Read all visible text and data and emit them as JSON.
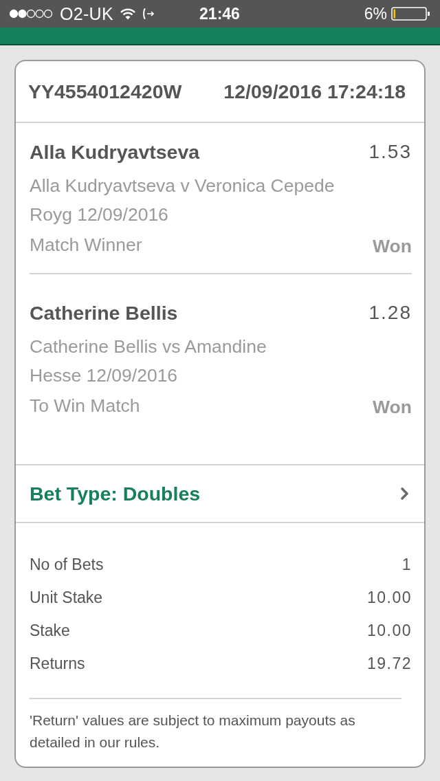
{
  "status_bar": {
    "carrier": "O2-UK",
    "time": "21:46",
    "battery": "6%"
  },
  "header": {
    "reference": "YY4554012420W",
    "date_time": "12/09/2016 17:24:18"
  },
  "selections": [
    {
      "name": "Alla Kudryavtseva",
      "odds": "1.53",
      "event_lines": [
        "Alla Kudryavtseva v Veronica Cepede",
        "Royg 12/09/2016"
      ],
      "market": "Match Winner",
      "result": "Won"
    },
    {
      "name": "Catherine Bellis",
      "odds": "1.28",
      "event_lines": [
        "Catherine Bellis vs Amandine",
        "Hesse 12/09/2016"
      ],
      "market": "To Win Match",
      "result": "Won"
    }
  ],
  "bet_type": {
    "label": "Bet Type: Doubles"
  },
  "summary": [
    {
      "label": "No of Bets",
      "value": "1"
    },
    {
      "label": "Unit Stake",
      "value": "10.00"
    },
    {
      "label": "Stake",
      "value": "10.00"
    },
    {
      "label": "Returns",
      "value": "19.72"
    }
  ],
  "disclaimer": "'Return' values are subject to maximum payouts as detailed in our rules."
}
